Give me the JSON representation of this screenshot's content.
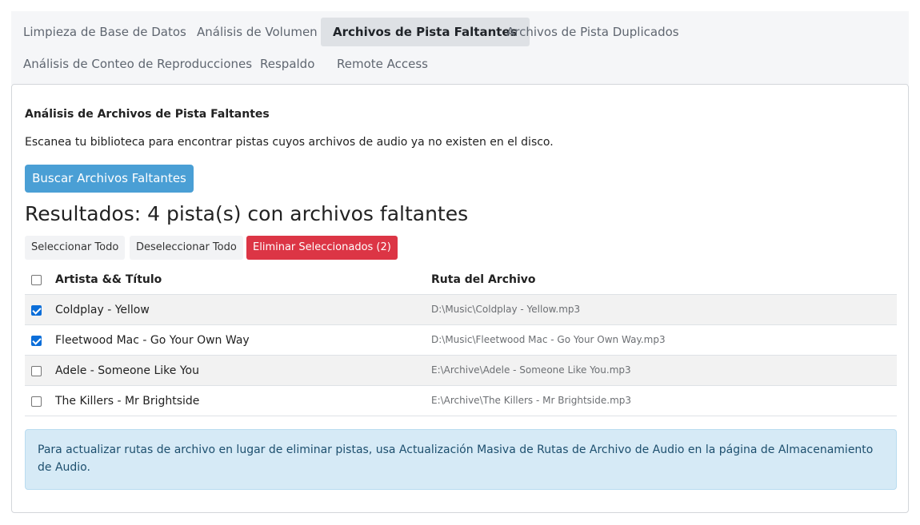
{
  "tabs": [
    {
      "label": "Limpieza de Base de Datos",
      "active": false
    },
    {
      "label": "Análisis de Volumen",
      "active": false
    },
    {
      "label": "Archivos de Pista Faltantes",
      "active": true
    },
    {
      "label": "Archivos de Pista Duplicados",
      "active": false
    },
    {
      "label": "Análisis de Conteo de Reproducciones",
      "active": false
    },
    {
      "label": "Respaldo",
      "active": false
    },
    {
      "label": "Remote Access",
      "active": false
    }
  ],
  "section": {
    "heading": "Análisis de Archivos de Pista Faltantes",
    "description": "Escanea tu biblioteca para encontrar pistas cuyos archivos de audio ya no existen en el disco.",
    "scan_button": "Buscar Archivos Faltantes",
    "results_title": "Resultados: 4 pista(s) con archivos faltantes"
  },
  "actions": {
    "select_all": "Seleccionar Todo",
    "deselect_all": "Deseleccionar Todo",
    "delete_selected": "Eliminar Seleccionados (2)"
  },
  "table": {
    "columns": [
      "Artista && Título",
      "Ruta del Archivo"
    ],
    "rows": [
      {
        "title": "Coldplay - Yellow",
        "path": "D:\\Music\\Coldplay - Yellow.mp3",
        "checked": true
      },
      {
        "title": "Fleetwood Mac - Go Your Own Way",
        "path": "D:\\Music\\Fleetwood Mac - Go Your Own Way.mp3",
        "checked": true
      },
      {
        "title": "Adele - Someone Like You",
        "path": "E:\\Archive\\Adele - Someone Like You.mp3",
        "checked": false
      },
      {
        "title": "The Killers - Mr Brightside",
        "path": "E:\\Archive\\The Killers - Mr Brightside.mp3",
        "checked": false
      }
    ]
  },
  "info_text": "Para actualizar rutas de archivo en lugar de eliminar pistas, usa Actualización Masiva de Rutas de Archivo de Audio en la página de Almacenamiento de Audio.",
  "colors": {
    "primary": "#4a9fd5",
    "danger": "#dc3545",
    "checkbox": "#0b6ed9",
    "info_bg": "#d6eaf6"
  }
}
